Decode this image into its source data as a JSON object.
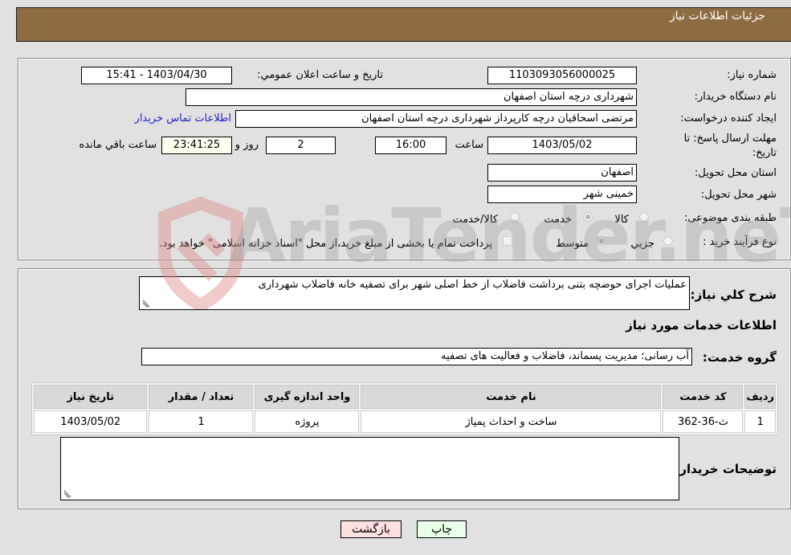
{
  "header": {
    "title": "جزئيات اطلاعات نياز"
  },
  "form": {
    "need_number_label": "شماره نیاز:",
    "need_number": "1103093056000025",
    "announce_label": "تاريخ و ساعت اعلان عمومي:",
    "announce_value": "1403/04/30 - 15:41",
    "buyer_org_label": "نام دستگاه خریدار:",
    "buyer_org": "شهرداری درچه استان اصفهان",
    "creator_label": "ایجاد کننده درخواست:",
    "creator": "مرتضی اسحاقیان درچه کارپرداز شهرداری درچه استان اصفهان",
    "contact_link": "اطلاعات تماس خریدار",
    "deadline_label_line1": "مهلت ارسال پاسخ: تا",
    "deadline_label_line2": "تاریخ:",
    "deadline_date": "1403/05/02",
    "time_label": "ساعت",
    "deadline_time": "16:00",
    "days": "2",
    "days_label": "روز و",
    "remaining": "23:41:25",
    "remaining_label": "ساعت باقي مانده",
    "province_label": "استان محل تحویل:",
    "province": "اصفهان",
    "city_label": "شهر محل تحویل:",
    "city": "خمینی شهر",
    "category_label": "طبقه بندی موضوعی:",
    "category_options": [
      {
        "label": "کالا",
        "checked": false
      },
      {
        "label": "خدمت",
        "checked": true
      },
      {
        "label": "کالا/خدمت",
        "checked": false
      }
    ],
    "process_label": "نوع فرآیند خرید :",
    "process_options": [
      {
        "label": "جزيي",
        "checked": false
      },
      {
        "label": "متوسط",
        "checked": true
      }
    ],
    "treasury_note": "پرداخت تمام یا بخشی از مبلغ خرید،از محل \"اسناد خزانه اسلامی\" خواهد بود."
  },
  "description": {
    "label": "شرح کلي نياز:",
    "value": "عملیات اجرای حوضچه بتنی  برداشت فاضلاب  از خط اصلی شهر برای تصفیه خانه فاضلاب شهرداری"
  },
  "services": {
    "section_title": "اطلاعات خدمات مورد نیاز",
    "group_label": "گروه خدمت:",
    "group_value": "آب رسانی؛ مدیریت پسماند، فاضلاب و فعالیت های تصفیه",
    "table": {
      "headers": [
        "ردیف",
        "کد خدمت",
        "نام خدمت",
        "واحد اندازه گیری",
        "تعداد / مقدار",
        "تاریخ نیاز"
      ],
      "rows": [
        [
          "1",
          "ث-36-362",
          "ساخت و احداث پمپاژ",
          "پروژه",
          "1",
          "1403/05/02"
        ]
      ]
    }
  },
  "buyer_notes": {
    "label": "توضیحات خریدار:",
    "value": ""
  },
  "buttons": {
    "print": "چاپ",
    "back": "بازگشت"
  },
  "colors": {
    "header_bg": "#8e6c42",
    "print_bg": "#eaffea",
    "back_bg": "#ffe0e0",
    "link": "#2323c8"
  },
  "watermark": "AriaTender.neT"
}
